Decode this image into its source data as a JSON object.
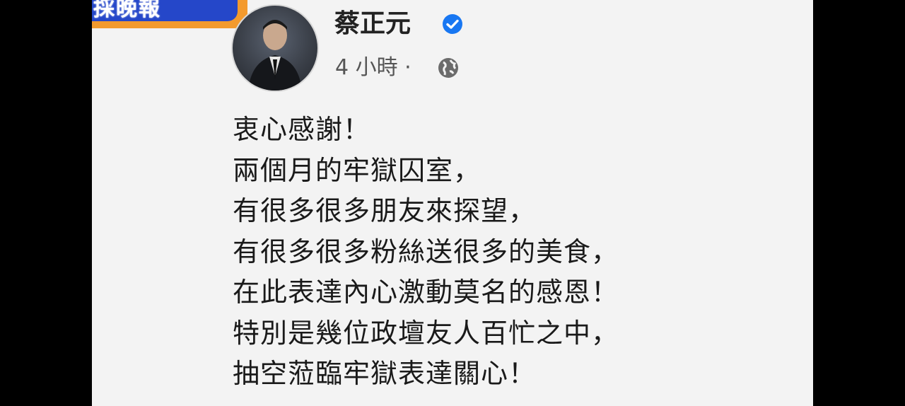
{
  "banner": {
    "text": "採晚報"
  },
  "post": {
    "author": "蔡正元",
    "verified": true,
    "timestamp": "4 小時 ·",
    "privacy_icon": "globe-icon",
    "lines": [
      "衷心感謝！",
      "兩個月的牢獄囚室，",
      "有很多很多朋友來探望，",
      "有很多很多粉絲送很多的美食，",
      "在此表達內心激動莫名的感恩！",
      "特別是幾位政壇友人百忙之中，",
      "抽空蒞臨牢獄表達關心！"
    ]
  },
  "colors": {
    "background": "#f3f3f3",
    "verified_badge": "#1877f2",
    "banner_blue": "#2547c9",
    "banner_orange": "#f39a2e"
  }
}
